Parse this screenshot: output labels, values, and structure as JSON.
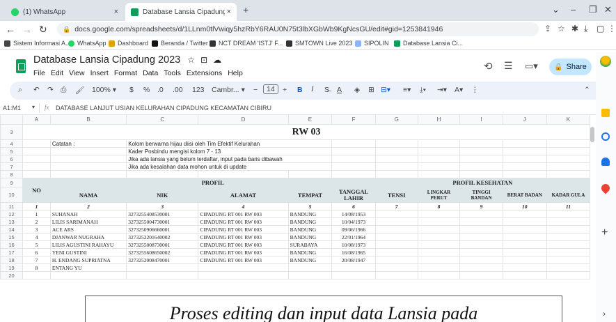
{
  "browser": {
    "tabs": [
      {
        "label": "(1) WhatsApp",
        "close": "×"
      },
      {
        "label": "Database Lansia Cipadung 2023",
        "close": "×"
      }
    ],
    "new_tab": "+",
    "url": "docs.google.com/spreadsheets/d/1LLnm0tlVwiqy5hzRbY6RAU0N75t3lbXGbWb9KgNcsGU/edit#gid=1253841946",
    "bookmarks": [
      "Sistem Informasi A...",
      "WhatsApp",
      "Dashboard",
      "Beranda / Twitter",
      "NCT DREAM 'ISTJ' F...",
      "SMTOWN Live 2023",
      "SIPOLIN",
      "Database Lansia Ci..."
    ],
    "colors": {
      "tabbar": "#dee3ea",
      "whatsapp": "#25d366",
      "sheets": "#0f9d58"
    }
  },
  "sheets": {
    "title": "Database Lansia Cipadung 2023",
    "menu": [
      "File",
      "Edit",
      "View",
      "Insert",
      "Format",
      "Data",
      "Tools",
      "Extensions",
      "Help"
    ],
    "share": "Share",
    "toolbar": {
      "zoom": "100%",
      "currency": "$",
      "percent": "%",
      "dec_down": ".0",
      "dec_up": ".00",
      "num_fmt": "123",
      "font": "Cambr...",
      "font_size": "14",
      "minus": "−",
      "plus": "+",
      "bold": "B",
      "italic": "I"
    },
    "name_box": "A1:M1",
    "fx": "fx",
    "formula": "DATABASE LANJUT USIAN KELURAHAN CIPADUNG KECAMATAN CIBIRU"
  },
  "grid": {
    "columns": [
      "A",
      "B",
      "C",
      "D",
      "E",
      "F",
      "G",
      "H",
      "I",
      "J",
      "K"
    ],
    "row_numbers": [
      "3",
      "4",
      "5",
      "6",
      "7",
      "8",
      "9",
      "10",
      "11",
      "12",
      "13",
      "14",
      "15",
      "16",
      "17",
      "18",
      "19",
      "20"
    ],
    "rw_title": "RW 03",
    "catatan_label": "Catatan :",
    "notes": [
      "Kolom berwarna hijau diisi oleh Tim Efektif Kelurahan",
      "Kader Posbindu mengisi kolom 7 - 13",
      "Jika ada lansia yang belum terdaftar, input pada baris dibawah",
      "Jika ada kesalahan data mohon untuk di  update"
    ],
    "profil": "PROFIL",
    "profil_kesehatan": "PROFIL KESEHATAN",
    "headers": [
      "NO",
      "NAMA",
      "NIK",
      "ALAMAT",
      "TEMPAT",
      "TANGGAL LAHIR",
      "TENSI",
      "LINGKAR PERUT",
      "TINGGI BANDAN",
      "BERAT BADAN",
      "KADAR GULA"
    ],
    "col_numbers": [
      "1",
      "2",
      "3",
      "4",
      "5",
      "6",
      "7",
      "8",
      "9",
      "10",
      "11"
    ],
    "rows": [
      [
        "1",
        "SUHANAH",
        "3273255408530001",
        "CIPADUNG RT 001 RW 003",
        "BANDUNG",
        "14/08/1953"
      ],
      [
        "2",
        "LILIS SARIMANAH",
        "3273255004730001",
        "CIPADUNG RT 001 RW 003",
        "BANDUNG",
        "10/04/1973"
      ],
      [
        "3",
        "ACE ARS",
        "3273250906660001",
        "CIPADUNG RT 001 RW 003",
        "BANDUNG",
        "09/06/1966"
      ],
      [
        "4",
        "DJANWAR NUGRAHA",
        "3273252201640002",
        "CIPADUNG RT 001 RW 003",
        "BANDUNG",
        "22/01/1964"
      ],
      [
        "5",
        "LILIS AGUSTINI RAHAYU",
        "3273255008730001",
        "CIPADUNG RT 001 RW 003",
        "SURABAYA",
        "10/08/1973"
      ],
      [
        "6",
        "YENI GUSTINI",
        "3273255608650002",
        "CIPADUNG RT 001 RW 003",
        "BANDUNG",
        "16/08/1965"
      ],
      [
        "7",
        "H. ENDANG SUPRIATNA",
        "3273252008470001",
        "CIPADUNG RT 001 RW 003",
        "BANDUNG",
        "20/08/1947"
      ],
      [
        "8",
        "ENTANG YU",
        "",
        "",
        "",
        ""
      ]
    ]
  },
  "caption": "Proses editing dan input data Lansia pada"
}
